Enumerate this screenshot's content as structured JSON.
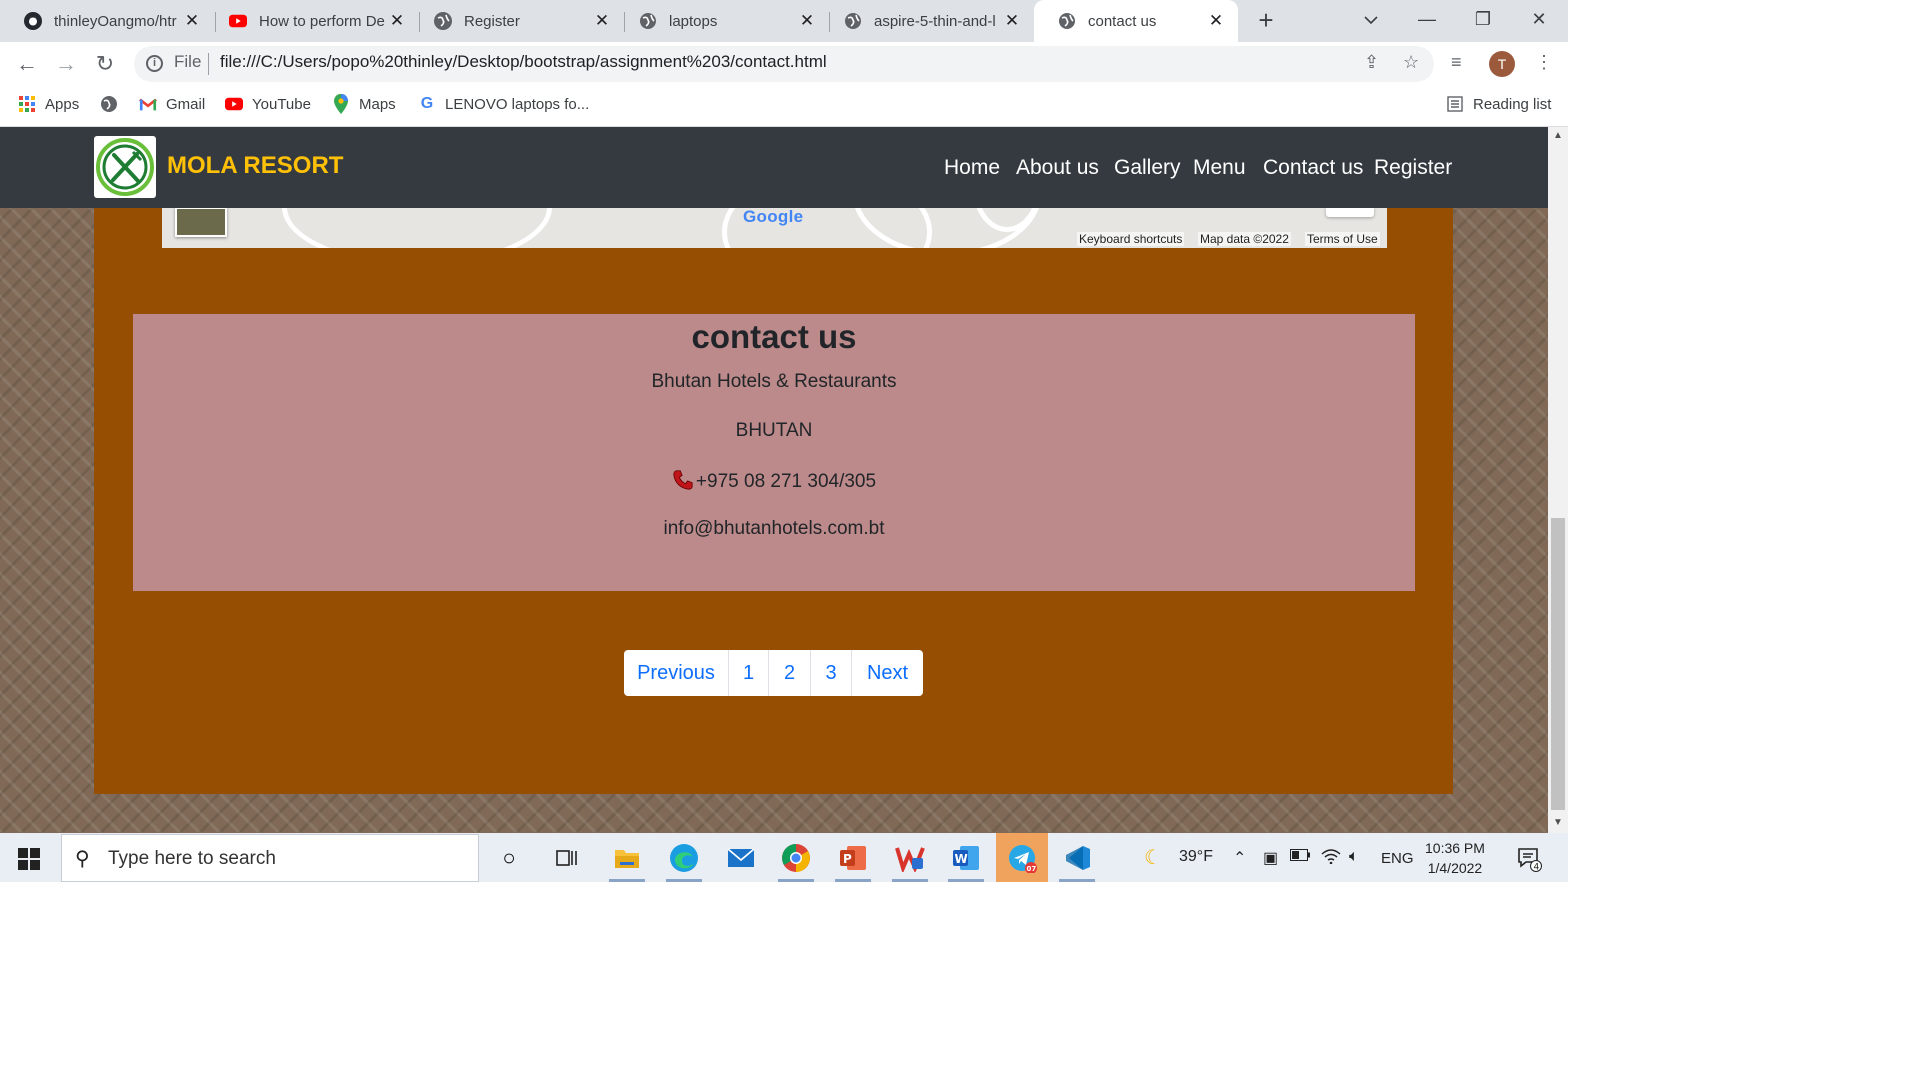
{
  "browser": {
    "tabs": [
      {
        "title": "thinleyOangmo/htr",
        "icon": "github-icon",
        "active": false
      },
      {
        "title": "How to perform De",
        "icon": "youtube-icon",
        "active": false
      },
      {
        "title": "Register",
        "icon": "globe-icon",
        "active": false
      },
      {
        "title": "laptops",
        "icon": "globe-icon",
        "active": false
      },
      {
        "title": "aspire-5-thin-and-l",
        "icon": "globe-icon",
        "active": false
      },
      {
        "title": "contact us",
        "icon": "globe-icon",
        "active": true
      }
    ],
    "address": {
      "scheme_label": "File",
      "url": "file:///C:/Users/popo%20thinley/Desktop/bootstrap/assignment%203/contact.html"
    },
    "profile_initial": "T",
    "bookmarks": [
      {
        "label": "Apps",
        "icon": "apps-grid-icon"
      },
      {
        "label": "",
        "icon": "globe-icon"
      },
      {
        "label": "Gmail",
        "icon": "gmail-icon"
      },
      {
        "label": "YouTube",
        "icon": "youtube-icon"
      },
      {
        "label": "Maps",
        "icon": "maps-pin-icon"
      },
      {
        "label": "LENOVO laptops fo...",
        "icon": "google-icon"
      }
    ],
    "reading_list": "Reading list"
  },
  "site": {
    "brand": "MOLA RESORT",
    "brand_color": "#ffc107",
    "nav": [
      "Home",
      "About us",
      "Gallery",
      "Menu",
      "Contact us",
      "Register"
    ]
  },
  "map": {
    "logo": "Google",
    "attribution": [
      "Keyboard shortcuts",
      "Map data ©2022",
      "Terms of Use"
    ]
  },
  "contact": {
    "title": "contact us",
    "org": "Bhutan Hotels & Restaurants",
    "country": "BHUTAN",
    "phone": "+975 08 271 304/305",
    "email": "info@bhutanhotels.com.bt"
  },
  "pagination": [
    "Previous",
    "1",
    "2",
    "3",
    "Next"
  ],
  "taskbar": {
    "search_placeholder": "Type here to search",
    "weather": "39°F",
    "language": "ENG",
    "time": "10:36 PM",
    "date": "1/4/2022",
    "notifications": "4",
    "telegram_badge": "07"
  }
}
